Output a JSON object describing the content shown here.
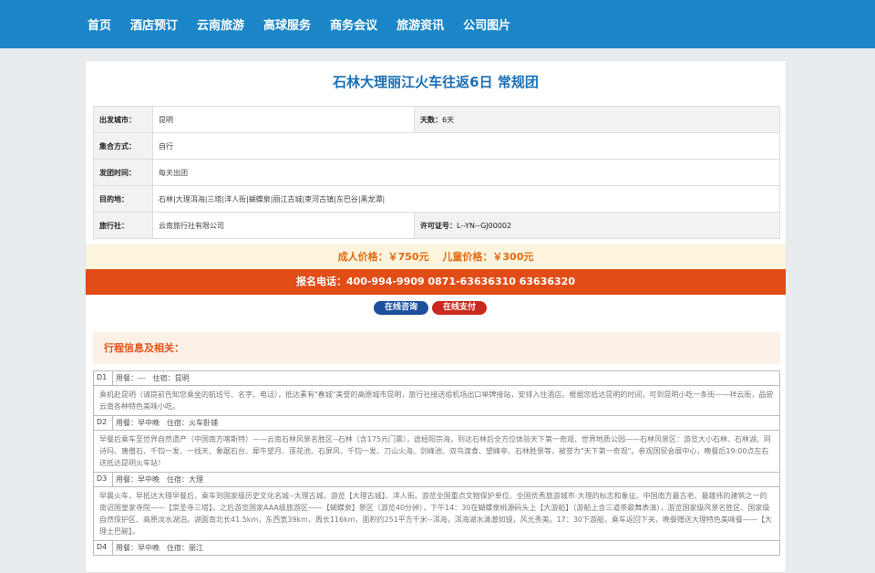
{
  "nav": [
    "首页",
    "酒店预订",
    "云南旅游",
    "高球服务",
    "商务会议",
    "旅游资讯",
    "公司图片"
  ],
  "title": "石林大理丽江火车往返6日 常规团",
  "info": {
    "depart_label": "出发城市：",
    "depart_value": "昆明",
    "days_label": "天数：",
    "days_value": "6天",
    "gather_label": "集合方式：",
    "gather_value": "自行",
    "time_label": "发团时间：",
    "time_value": "每天出团",
    "dest_label": "目的地：",
    "dest_value": "石林|大理洱海|三塔|洋人街|蝴蝶泉|丽江古城|束河古镇|东巴谷|黑龙潭|",
    "agency_label": "旅行社：",
    "agency_value": "云南旅行社有限公司",
    "license_label": "许可证号：",
    "license_value": "L--YN--GJ00002"
  },
  "price": "成人价格：￥750元　 儿童价格：￥300元",
  "phone": "报名电话：400-994-9909 0871-63636310 63636320",
  "buttons": {
    "consult": "在线咨询",
    "pay": "在线支付"
  },
  "section_title": "行程信息及相关：",
  "itinerary": [
    {
      "day": "D1",
      "meal": "用餐：---　住宿：昆明",
      "desc": "乘机赴昆明（请提前告知您乘坐的航班号、名字、电话），抵达素有\"春城\"美誉的高原城市昆明，旅行社接送组机场出口举牌接站，安排入住酒店。根据您抵达昆明的时间，可到昆明小吃一条街——祥云街，品尝云南各种特色美味小吃。"
    },
    {
      "day": "D2",
      "meal": "用餐：早中晚　住宿：火车卧铺",
      "desc": "早餐后乘车至世界自然遗产（中国南方喀斯特）——云南石林风景名胜区--石林（含175元门票），途经阳宗海，到达石林后全方位体验天下第一奇观、世界地质公园——石林风景区：游览大小石林、石林湖、阿诗玛、唐僧石、千钧一发、一线天、象踞石台、犀牛望月、莲花池、石屏风、千钧一发、刀山火海、剑峰池、双鸟渡食、望峰亭、石林胜景等，被誉为\"天下第一奇观\"。参观国贸会展中心，晚餐后19:00点左右送抵达昆明火车站！"
    },
    {
      "day": "D3",
      "meal": "用餐：早中晚　住宿：大理",
      "desc": "早晨火车，早抵达大理早餐后，乘车到国家级历史文化名城--大理古城，游览【大理古城】、洋人街。游览全国重点文物保护单位、全国优秀旅游城市-大理的标志和象征、中国南方最古老、最雄伟的建筑之一的南诏国皇家寺院——【崇圣寺三塔】。之后游览国家AAA级旅游区——【蝴蝶泉】景区（游览40分钟），下午14：30在蝴蝶泉桃源码头上【大游船】（游船上含三道茶歌舞表演），游览国家级风景名胜区、国家级自然保护区、高原淡水湖泊。湖面南北长41.5km，东西宽39km，周长116km，面积约251平方千米--洱海，洱海湖水清澈如镜，风光秀美。17：30下游船，乘车返回下关，晚餐赠送大理特色美味餐——【大理土巴碗】。"
    },
    {
      "day": "D4",
      "meal": "用餐：早中晚　住宿：丽江",
      "desc": ""
    }
  ]
}
